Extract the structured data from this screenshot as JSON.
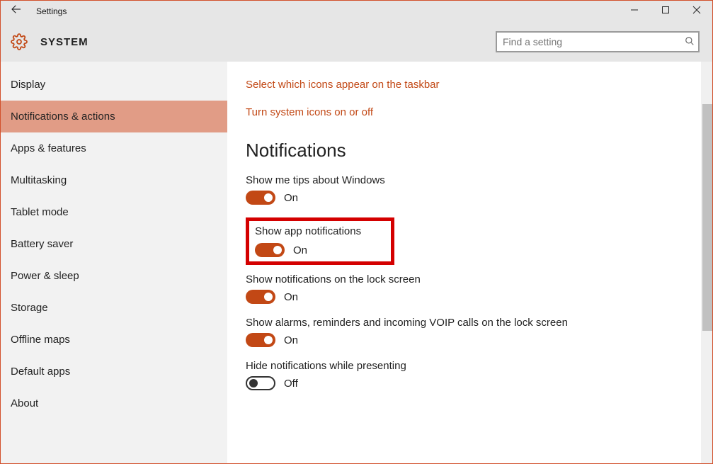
{
  "window": {
    "title": "Settings",
    "page_title": "SYSTEM"
  },
  "search": {
    "placeholder": "Find a setting"
  },
  "sidebar": {
    "items": [
      {
        "label": "Display",
        "active": false
      },
      {
        "label": "Notifications & actions",
        "active": true
      },
      {
        "label": "Apps & features",
        "active": false
      },
      {
        "label": "Multitasking",
        "active": false
      },
      {
        "label": "Tablet mode",
        "active": false
      },
      {
        "label": "Battery saver",
        "active": false
      },
      {
        "label": "Power & sleep",
        "active": false
      },
      {
        "label": "Storage",
        "active": false
      },
      {
        "label": "Offline maps",
        "active": false
      },
      {
        "label": "Default apps",
        "active": false
      },
      {
        "label": "About",
        "active": false
      }
    ]
  },
  "content": {
    "links": [
      "Select which icons appear on the taskbar",
      "Turn system icons on or off"
    ],
    "section_title": "Notifications",
    "settings": [
      {
        "label": "Show me tips about Windows",
        "on": true,
        "state": "On",
        "highlight": false
      },
      {
        "label": "Show app notifications",
        "on": true,
        "state": "On",
        "highlight": true
      },
      {
        "label": "Show notifications on the lock screen",
        "on": true,
        "state": "On",
        "highlight": false
      },
      {
        "label": "Show alarms, reminders and incoming VOIP calls on the lock screen",
        "on": true,
        "state": "On",
        "highlight": false
      },
      {
        "label": "Hide notifications while presenting",
        "on": false,
        "state": "Off",
        "highlight": false
      }
    ]
  }
}
